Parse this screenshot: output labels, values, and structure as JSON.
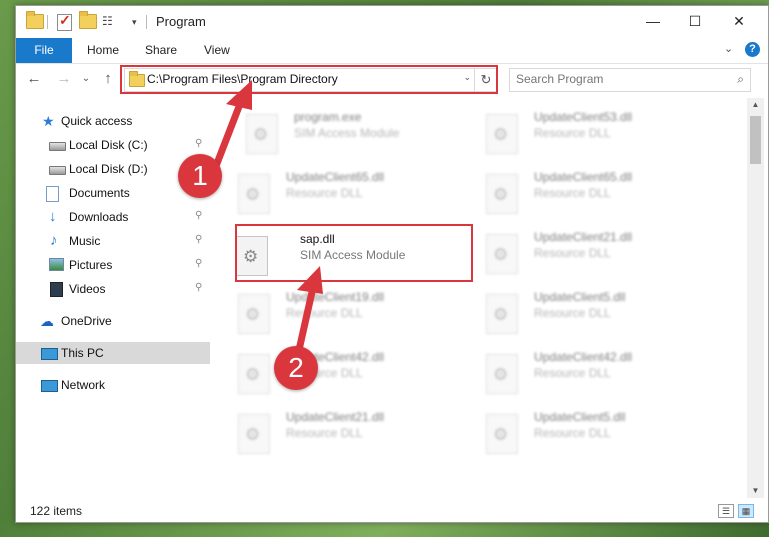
{
  "window": {
    "title": "Program",
    "minimize": "—",
    "maximize": "☐",
    "close": "✕"
  },
  "ribbon": {
    "tabs": [
      "File",
      "Home",
      "Share",
      "View"
    ],
    "collapse": "⌄",
    "help": "?"
  },
  "nav": {
    "back": "←",
    "forward": "→",
    "recent": "⌄",
    "up": "↑",
    "address": "C:\\Program Files\\Program Directory",
    "address_dropdown": "⌄",
    "refresh": "↻",
    "search_placeholder": "Search Program",
    "search_icon": "⌕"
  },
  "sidebar": {
    "items": [
      {
        "label": "Quick access",
        "icon": "star-icon"
      },
      {
        "label": "Local Disk (C:)",
        "icon": "drive-icon"
      },
      {
        "label": "Local Disk (D:)",
        "icon": "drive-icon"
      },
      {
        "label": "Documents",
        "icon": "documents-icon"
      },
      {
        "label": "Downloads",
        "icon": "download-icon"
      },
      {
        "label": "Music",
        "icon": "music-icon"
      },
      {
        "label": "Pictures",
        "icon": "pictures-icon"
      },
      {
        "label": "Videos",
        "icon": "videos-icon"
      },
      {
        "label": "OneDrive",
        "icon": "cloud-icon"
      },
      {
        "label": "This PC",
        "icon": "computer-icon"
      },
      {
        "label": "Network",
        "icon": "network-icon"
      }
    ],
    "pin_glyph": "📌"
  },
  "files": [
    {
      "name": "program.exe",
      "desc": "SIM Access Module"
    },
    {
      "name": "UpdateClient53.dll",
      "desc": "Resource DLL"
    },
    {
      "name": "UpdateClient65.dll",
      "desc": "Resource DLL"
    },
    {
      "name": "UpdateClient65.dll",
      "desc": "Resource DLL"
    },
    {
      "name": "sap.dll",
      "desc": "SIM Access Module"
    },
    {
      "name": "UpdateClient21.dll",
      "desc": "Resource DLL"
    },
    {
      "name": "UpdateClient19.dll",
      "desc": "Resource DLL"
    },
    {
      "name": "UpdateClient5.dll",
      "desc": "Resource DLL"
    },
    {
      "name": "UpdateClient42.dll",
      "desc": "Resource DLL"
    },
    {
      "name": "UpdateClient42.dll",
      "desc": "Resource DLL"
    },
    {
      "name": "UpdateClient21.dll",
      "desc": "Resource DLL"
    },
    {
      "name": "UpdateClient5.dll",
      "desc": "Resource DLL"
    }
  ],
  "status": {
    "items": "122 items",
    "details_view": "☰",
    "tiles_view": "▦"
  },
  "annotations": {
    "step1": "1",
    "step2": "2",
    "color": "#d9363e"
  },
  "scrollbar": {
    "up": "▲",
    "down": "▼"
  }
}
